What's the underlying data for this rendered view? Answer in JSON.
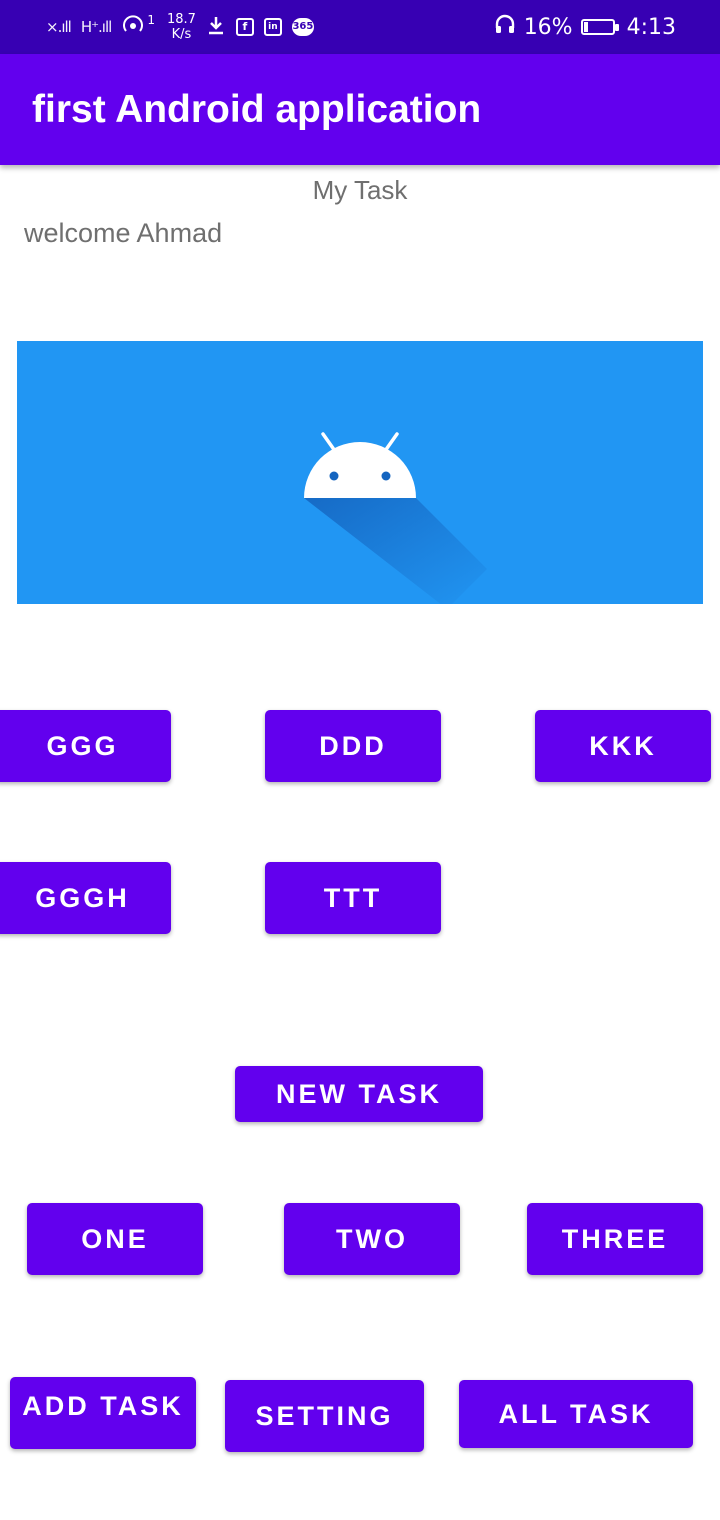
{
  "status_bar": {
    "signal_1": "×.ıll",
    "signal_2": "H⁺.ıll",
    "hotspot_badge": "1",
    "net_speed_value": "18.7",
    "net_speed_unit": "K/s",
    "app_icon_fb": "f",
    "app_icon_in": "in",
    "app_icon_365": "365",
    "battery_percent": "16%",
    "battery_level": 0.16,
    "time": "4:13"
  },
  "app_bar": {
    "title": "first Android application"
  },
  "content": {
    "heading": "My Task",
    "welcome": "welcome Ahmad",
    "banner_color": "#2196f3",
    "banner_icon": "android-icon"
  },
  "buttons": {
    "ggg": "GGG",
    "ddd": "DDD",
    "kkk": "KKK",
    "gggh": "GGGH",
    "ttt": "TTT",
    "new_task": "NEW TASK",
    "one": "ONE",
    "two": "TWO",
    "three": "THREE",
    "add_task": "ADD TASK",
    "setting": "SETTING",
    "all_task": "ALL TASK"
  },
  "colors": {
    "status_bar": "#3700b3",
    "primary": "#6200ee",
    "banner": "#2196f3"
  }
}
